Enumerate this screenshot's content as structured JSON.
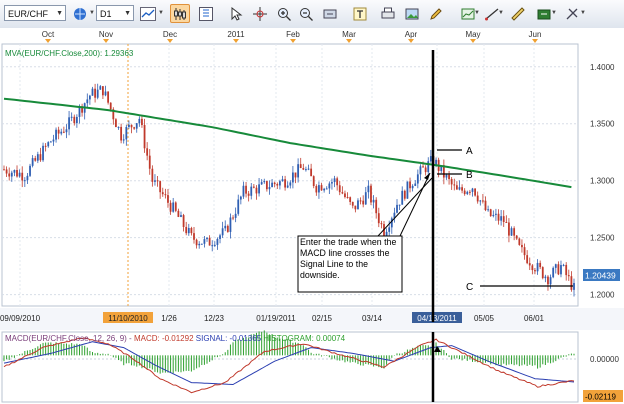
{
  "toolbar": {
    "symbol": "EUR/CHF",
    "timeframe": "D1",
    "icons": [
      "globe-icon",
      "line-chart-icon",
      "bar-chart-icon",
      "candlestick-icon",
      "grid-icon",
      "cursor-icon",
      "crosshair-icon",
      "zoom-in-icon",
      "zoom-out-icon",
      "scroll-icon",
      "pencil-icon",
      "draw-line-icon",
      "ruler-icon",
      "image-icon",
      "text-icon",
      "settings-icon",
      "print-icon",
      "export-icon"
    ]
  },
  "chart_data": [
    {
      "type": "candlestick",
      "symbol": "EUR/CHF",
      "timeframe": "D1",
      "title": "",
      "ma_label": "MVA(EUR/CHF.Close,200): 1.29363",
      "top_months": [
        "Oct",
        "Nov",
        "Dec",
        "2011",
        "Feb",
        "Mar",
        "Apr",
        "May",
        "Jun"
      ],
      "x_ticks": [
        "09/09/2010",
        "11/10/2010",
        "1/26",
        "12/23",
        "01/19/2011",
        "02/15",
        "03/14",
        "04/13/2011",
        "05/05",
        "06/01"
      ],
      "highlighted_dates": [
        "11/10/2010",
        "04/13/2011"
      ],
      "ylim": [
        1.19,
        1.42
      ],
      "y_ticks": [
        "1.4000",
        "1.3500",
        "1.3000",
        "1.2500",
        "1.2000"
      ],
      "last_price": "1.20439",
      "price_anchors": [
        {
          "t": 0,
          "close": 1.31
        },
        {
          "t": 8,
          "close": 1.305
        },
        {
          "t": 18,
          "close": 1.335
        },
        {
          "t": 25,
          "close": 1.35
        },
        {
          "t": 33,
          "close": 1.375
        },
        {
          "t": 38,
          "close": 1.38
        },
        {
          "t": 45,
          "close": 1.34
        },
        {
          "t": 52,
          "close": 1.355
        },
        {
          "t": 57,
          "close": 1.3
        },
        {
          "t": 65,
          "close": 1.275
        },
        {
          "t": 72,
          "close": 1.25
        },
        {
          "t": 78,
          "close": 1.245
        },
        {
          "t": 85,
          "close": 1.255
        },
        {
          "t": 92,
          "close": 1.29
        },
        {
          "t": 100,
          "close": 1.295
        },
        {
          "t": 108,
          "close": 1.3
        },
        {
          "t": 115,
          "close": 1.312
        },
        {
          "t": 120,
          "close": 1.295
        },
        {
          "t": 127,
          "close": 1.3
        },
        {
          "t": 134,
          "close": 1.275
        },
        {
          "t": 140,
          "close": 1.29
        },
        {
          "t": 146,
          "close": 1.255
        },
        {
          "t": 151,
          "close": 1.28
        },
        {
          "t": 157,
          "close": 1.3
        },
        {
          "t": 162,
          "close": 1.312
        },
        {
          "t": 165,
          "close": 1.318
        },
        {
          "t": 169,
          "close": 1.305
        },
        {
          "t": 174,
          "close": 1.29
        },
        {
          "t": 180,
          "close": 1.295
        },
        {
          "t": 186,
          "close": 1.27
        },
        {
          "t": 192,
          "close": 1.265
        },
        {
          "t": 198,
          "close": 1.24
        },
        {
          "t": 204,
          "close": 1.225
        },
        {
          "t": 209,
          "close": 1.215
        },
        {
          "t": 214,
          "close": 1.225
        },
        {
          "t": 219,
          "close": 1.205
        }
      ],
      "ma_anchors": [
        {
          "t": 0,
          "v": 1.372
        },
        {
          "t": 40,
          "v": 1.362
        },
        {
          "t": 80,
          "v": 1.347
        },
        {
          "t": 110,
          "v": 1.333
        },
        {
          "t": 140,
          "v": 1.322
        },
        {
          "t": 165,
          "v": 1.314
        },
        {
          "t": 190,
          "v": 1.305
        },
        {
          "t": 219,
          "v": 1.294
        }
      ],
      "annotations": [
        {
          "label": "A"
        },
        {
          "label": "B"
        },
        {
          "label": "C"
        },
        {
          "label": "note",
          "text": "Enter the trade when the MACD line crosses the Signal Line to the downside."
        }
      ]
    },
    {
      "type": "line",
      "title": "MACD(EUR/CHF.Close, 12, 26, 9)",
      "legend": [
        {
          "name": "MACD: -0.01292",
          "color": "#c0392b"
        },
        {
          "name": "SIGNAL: -0.01365",
          "color": "#2a3eb1"
        },
        {
          "name": "HISTOGRAM: 0.00074",
          "color": "#2ea02e"
        }
      ],
      "y_ticks": [
        "0.00000",
        "-0.02119"
      ],
      "ylim": [
        -0.024,
        0.012
      ],
      "macd_anchors": [
        {
          "t": 0,
          "v": -0.006
        },
        {
          "t": 15,
          "v": 0.004
        },
        {
          "t": 30,
          "v": 0.009
        },
        {
          "t": 40,
          "v": 0.006
        },
        {
          "t": 50,
          "v": -0.002
        },
        {
          "t": 60,
          "v": -0.012
        },
        {
          "t": 72,
          "v": -0.019
        },
        {
          "t": 85,
          "v": -0.014
        },
        {
          "t": 100,
          "v": 0.002
        },
        {
          "t": 115,
          "v": 0.006
        },
        {
          "t": 130,
          "v": 0.0
        },
        {
          "t": 146,
          "v": -0.006
        },
        {
          "t": 160,
          "v": 0.005
        },
        {
          "t": 166,
          "v": 0.008
        },
        {
          "t": 175,
          "v": 0.002
        },
        {
          "t": 190,
          "v": -0.008
        },
        {
          "t": 205,
          "v": -0.016
        },
        {
          "t": 219,
          "v": -0.013
        }
      ],
      "signal_anchors": [
        {
          "t": 0,
          "v": -0.004
        },
        {
          "t": 18,
          "v": 0.001
        },
        {
          "t": 34,
          "v": 0.007
        },
        {
          "t": 46,
          "v": 0.004
        },
        {
          "t": 58,
          "v": -0.005
        },
        {
          "t": 72,
          "v": -0.014
        },
        {
          "t": 88,
          "v": -0.015
        },
        {
          "t": 104,
          "v": -0.003
        },
        {
          "t": 118,
          "v": 0.004
        },
        {
          "t": 134,
          "v": 0.001
        },
        {
          "t": 150,
          "v": -0.003
        },
        {
          "t": 164,
          "v": 0.004
        },
        {
          "t": 172,
          "v": 0.005
        },
        {
          "t": 186,
          "v": -0.003
        },
        {
          "t": 204,
          "v": -0.012
        },
        {
          "t": 219,
          "v": -0.0137
        }
      ]
    }
  ]
}
